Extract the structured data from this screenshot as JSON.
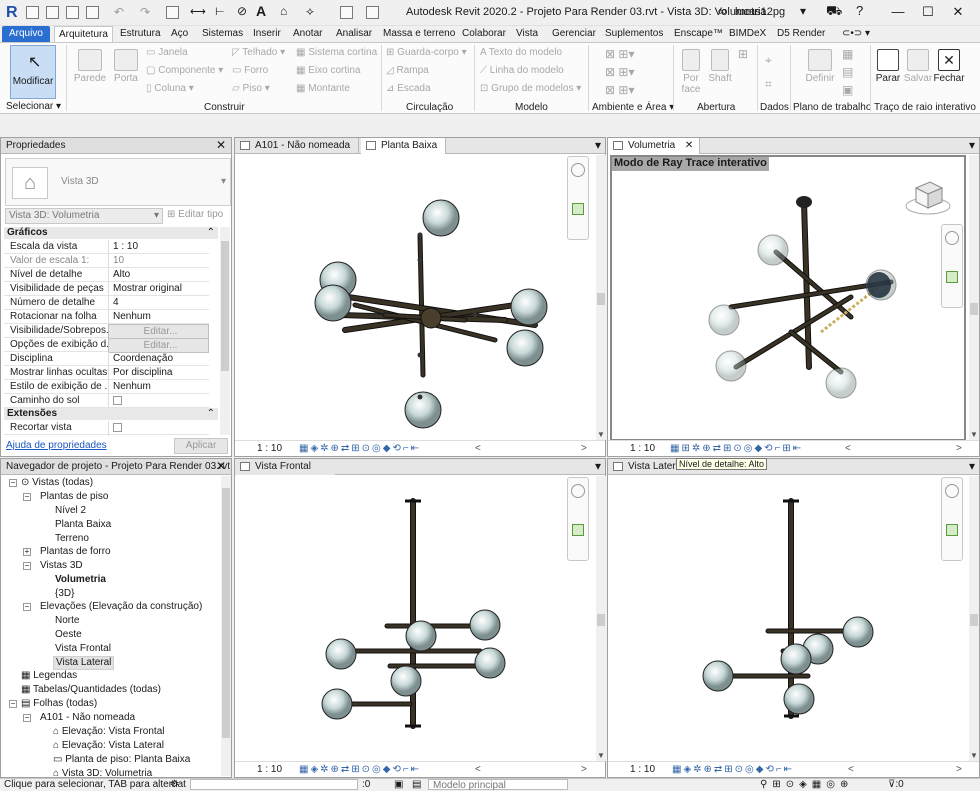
{
  "window": {
    "title": "Autodesk Revit 2020.2 - Projeto Para Render 03.rvt - Vista 3D: Volumetria",
    "user": "lucas12pg"
  },
  "icons": {
    "logo": "revit-logo",
    "minimize": "minimize-icon",
    "maximize": "maximize-icon",
    "close": "close-icon"
  },
  "ribbon_tabs": [
    "Arquivo",
    "Arquitetura",
    "Estrutura",
    "Aço",
    "Sistemas",
    "Inserir",
    "Anotar",
    "Analisar",
    "Massa e terreno",
    "Colaborar",
    "Vista",
    "Gerenciar",
    "Suplementos",
    "Enscape™",
    "BIMDeX",
    "D5 Render"
  ],
  "ribbon": {
    "modificar": "Modificar",
    "selecionar": "Selecionar ▾",
    "parede": "Parede",
    "porta": "Porta",
    "construir_items": [
      "Janela",
      "Componente ▾",
      "Coluna ▾",
      "Telhado ▾",
      "Forro",
      "Piso ▾",
      "Sistema cortina",
      "Eixo cortina",
      "Montante"
    ],
    "circulacao_items": [
      "Guarda-corpo ▾",
      "Rampa",
      "Escada"
    ],
    "modelo_items": [
      "Texto do modelo",
      "Linha do modelo",
      "Grupo de modelos ▾"
    ],
    "porface": "Por face",
    "shaft": "Shaft",
    "definir": "Definir",
    "parar": "Parar",
    "salvar": "Salvar",
    "fechar": "Fechar",
    "panels": [
      "Construir",
      "Circulação",
      "Modelo",
      "Ambiente e Área ▾",
      "Abertura",
      "Dados",
      "Plano de trabalho",
      "Traço de raio interativo"
    ]
  },
  "properties": {
    "header": "Propriedades",
    "type_name": "Vista 3D",
    "selector": "Vista 3D: Volumetria",
    "edit_type": "Editar tipo",
    "section_graficos": "Gráficos",
    "rows": [
      {
        "k": "Escala da vista",
        "v": "1 : 10"
      },
      {
        "k": "Valor de escala    1:",
        "v": "10"
      },
      {
        "k": "Nível de detalhe",
        "v": "Alto"
      },
      {
        "k": "Visibilidade de peças",
        "v": "Mostrar original"
      },
      {
        "k": "Número de detalhe",
        "v": "4"
      },
      {
        "k": "Rotacionar na folha",
        "v": "Nenhum"
      },
      {
        "k": "Visibilidade/Sobrepos...",
        "v": "Editar..."
      },
      {
        "k": "Opções de exibição d...",
        "v": "Editar..."
      },
      {
        "k": "Disciplina",
        "v": "Coordenação"
      },
      {
        "k": "Mostrar linhas ocultas",
        "v": "Por disciplina"
      },
      {
        "k": "Estilo de exibição de ...",
        "v": "Nenhum"
      },
      {
        "k": "Caminho do sol",
        "v": ""
      }
    ],
    "section_extensoes": "Extensões",
    "row_recortar": "Recortar vista",
    "help_link": "Ajuda de propriedades",
    "apply": "Aplicar"
  },
  "navigator": {
    "header": "Navegador de projeto - Projeto Para Render 03.rvt",
    "items": [
      "Vistas (todas)",
      "Plantas de piso",
      "Nível 2",
      "Planta Baixa",
      "Terreno",
      "Plantas de forro",
      "Vistas 3D",
      "Volumetria",
      "{3D}",
      "Elevações (Elevação da construção)",
      "Norte",
      "Oeste",
      "Vista Frontal",
      "Vista Lateral",
      "Legendas",
      "Tabelas/Quantidades (todas)",
      "Folhas (todas)",
      "A101 - Não nomeada",
      "Elevação: Vista Frontal",
      "Elevação: Vista Lateral",
      "Planta de piso: Planta Baixa",
      "Vista 3D: Volumetria"
    ]
  },
  "views": {
    "tab_a101": "A101 - Não nomeada",
    "tab_planta": "Planta Baixa",
    "tab_volumetria": "Volumetria",
    "tab_frontal": "Vista Frontal",
    "tab_lateral": "Vista Lateral",
    "scale": "1 : 10",
    "ray_trace_label": "Modo de Ray Trace interativo",
    "tooltip": "Nível de detalhe: Alto"
  },
  "status": {
    "left": "Clique para selecionar, TAB para alternat",
    "zero": ":0",
    "model": "Modelo principal"
  },
  "colors": {
    "accent": "#2a6fd0",
    "metal": "#3a3224",
    "sphere": "#c8d8d8"
  }
}
